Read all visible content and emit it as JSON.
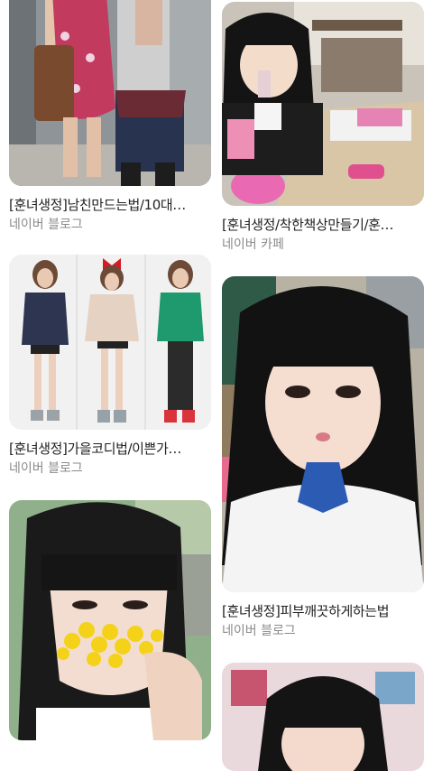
{
  "results": [
    {
      "title": "[훈녀생정]남친만드는법/10대…",
      "source": "네이버 블로그",
      "image": "two-people-street-photo"
    },
    {
      "title": "[훈녀생정/착한책상만들기/훈…",
      "source": "네이버 카페",
      "image": "girl-at-school-desk-photo"
    },
    {
      "title": "[훈녀생정]가을코디법/이쁜가…",
      "source": "네이버 블로그",
      "image": "three-outfits-photo"
    },
    {
      "title": "[훈녀생정]피부깨끗하게하는법",
      "source": "네이버 블로그",
      "image": "girl-selfie-classroom-photo"
    },
    {
      "title": "",
      "source": "",
      "image": "girl-with-yellow-flowers-photo"
    },
    {
      "title": "",
      "source": "",
      "image": "girl-in-classroom-photo"
    }
  ],
  "colors": {
    "title": "#222222",
    "source": "#8a8a8a",
    "background": "#ffffff"
  }
}
